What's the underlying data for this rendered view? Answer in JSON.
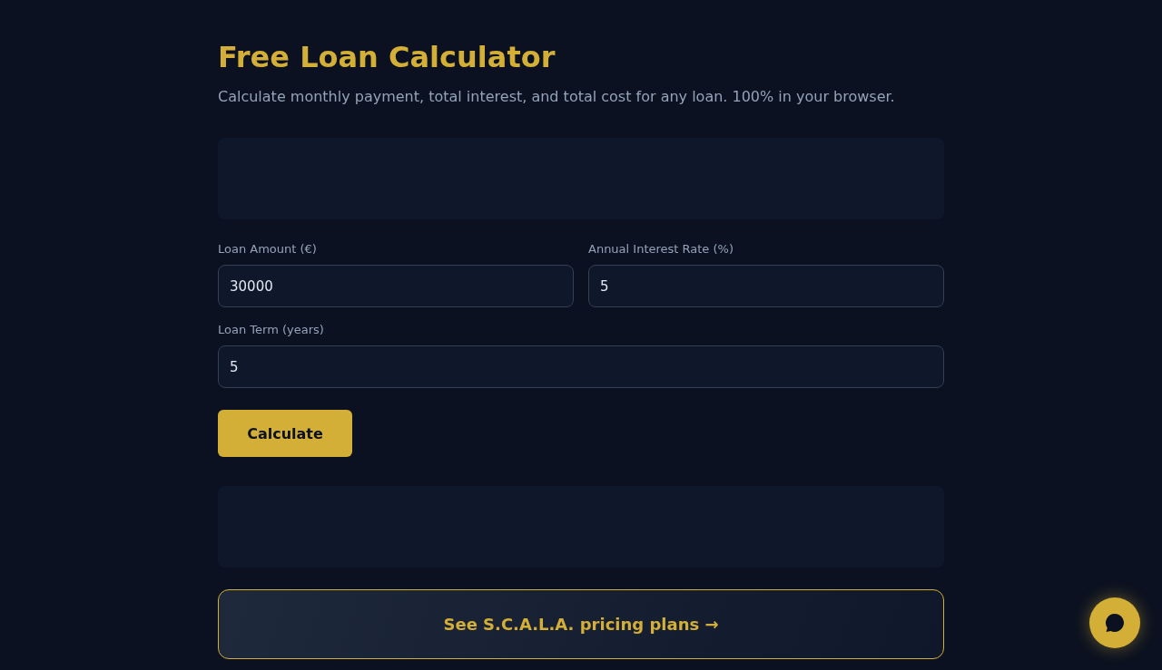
{
  "header": {
    "title": "Free Loan Calculator",
    "subtitle": "Calculate monthly payment, total interest, and total cost for any loan. 100% in your browser."
  },
  "form": {
    "fields": [
      {
        "label": "Loan Amount (€)",
        "value": "30000"
      },
      {
        "label": "Annual Interest Rate (%)",
        "value": "5"
      },
      {
        "label": "Loan Term (years)",
        "value": "5"
      }
    ],
    "button": "Calculate"
  },
  "cta": {
    "label": "See S.C.A.L.A. pricing plans →"
  }
}
